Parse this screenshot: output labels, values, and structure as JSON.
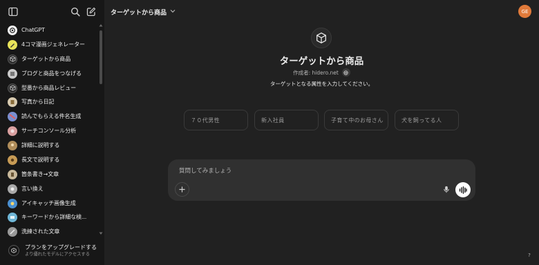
{
  "sidebar": {
    "toggle_icon": "sidebar-toggle-icon",
    "search_icon": "search-icon",
    "new_chat_icon": "new-chat-icon",
    "items": [
      {
        "label": "ChatGPT",
        "icon": "openai-logo",
        "color": "#f2f2f2"
      },
      {
        "label": "4コマ漫画ジェネレーター",
        "icon": "manga-thumb",
        "color": "#e8e35a"
      },
      {
        "label": "ターゲットから商品",
        "icon": "cube-icon",
        "color": "#2f2f2f"
      },
      {
        "label": "ブログと商品をつなげる",
        "icon": "blog-thumb",
        "color": "#c9c9c9"
      },
      {
        "label": "型番から商品レビュー",
        "icon": "cube-icon",
        "color": "#2f2f2f"
      },
      {
        "label": "写真から日記",
        "icon": "diary-thumb",
        "color": "#d8cbb0"
      },
      {
        "label": "読んでもらえる件名生成",
        "icon": "mail-thumb",
        "color": "#7a8fd0"
      },
      {
        "label": "サーチコンソール分析",
        "icon": "analysis-thumb",
        "color": "#d9a0a0"
      },
      {
        "label": "詳細に説明する",
        "icon": "explain-thumb",
        "color": "#b08d5a"
      },
      {
        "label": "長文で説明する",
        "icon": "longtext-thumb",
        "color": "#c79b55"
      },
      {
        "label": "箇条書き→文章",
        "icon": "bullet-thumb",
        "color": "#c8b89a"
      },
      {
        "label": "言い換え",
        "icon": "paraphrase-thumb",
        "color": "#a9a9a9"
      },
      {
        "label": "アイキャッチ画像生成",
        "icon": "eyecatch-thumb",
        "color": "#4a8fd0"
      },
      {
        "label": "キーワードから詳細な検...",
        "icon": "keyword-thumb",
        "color": "#6fb6d6"
      },
      {
        "label": "洗練された文章",
        "icon": "refined-thumb",
        "color": "#9a9a9a"
      }
    ],
    "upgrade": {
      "title": "プランをアップグレードする",
      "subtitle": "より優れたモデルにアクセスする"
    }
  },
  "header": {
    "model_label": "ターゲットから商品",
    "user_initials": "GE",
    "user_color": "#e07a3a"
  },
  "gpt": {
    "title": "ターゲットから商品",
    "author": "作成者: hidero.net",
    "description": "ターゲットとなる属性を入力してください。"
  },
  "starters": [
    "７０代男性",
    "新入社員",
    "子育て中のお母さん",
    "犬を飼ってる人"
  ],
  "composer": {
    "placeholder": "質問してみましょう"
  },
  "help_label": "?"
}
